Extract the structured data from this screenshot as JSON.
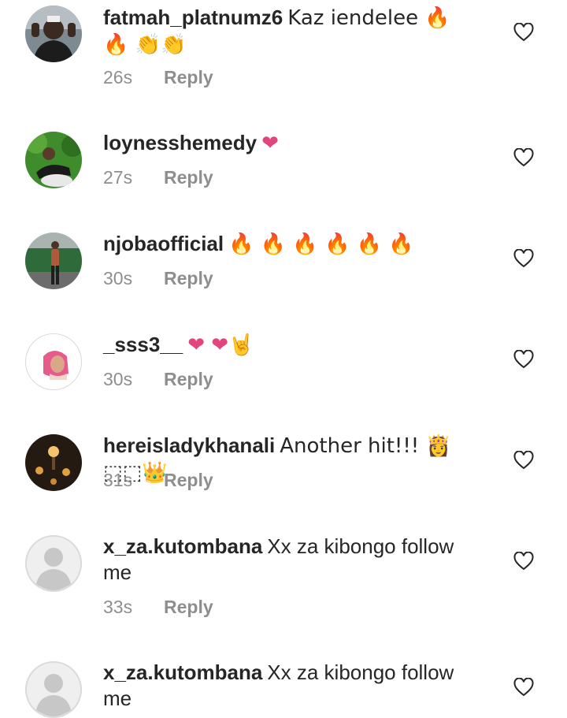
{
  "comments": [
    {
      "username": "fatmah_platnumz6",
      "text": "Kaz iendelee 🔥 🔥 👏👏",
      "time": "26s",
      "reply": "Reply",
      "avatar": "avatar-dark-man"
    },
    {
      "username": "loynesshemedy",
      "text": "❤",
      "time": "27s",
      "reply": "Reply",
      "avatar": "avatar-green-woman"
    },
    {
      "username": "njobaofficial",
      "text": "🔥 🔥 🔥 🔥 🔥 🔥",
      "time": "30s",
      "reply": "Reply",
      "avatar": "avatar-standing-woman"
    },
    {
      "username": "_sss3__",
      "text": "❤ ❤🤘",
      "time": "30s",
      "reply": "Reply",
      "avatar": "avatar-pink-woman"
    },
    {
      "username": "hereisladykhanali",
      "text": "Another hit!!! 👸 ⬚⬚👑",
      "time": "31s",
      "reply": "Reply",
      "avatar": "avatar-candles"
    },
    {
      "username": "x_za.kutombana",
      "text": "Xx za kibongo follow me",
      "time": "33s",
      "reply": "Reply",
      "avatar": "avatar-default"
    },
    {
      "username": "x_za.kutombana",
      "text": "Xx za kibongo follow me",
      "time": "",
      "reply": "",
      "avatar": "avatar-default"
    }
  ],
  "icons": {
    "like": "heart-outline-icon"
  },
  "colors": {
    "text": "#262626",
    "meta": "#8e8e8e",
    "heart_stroke": "#262626"
  }
}
